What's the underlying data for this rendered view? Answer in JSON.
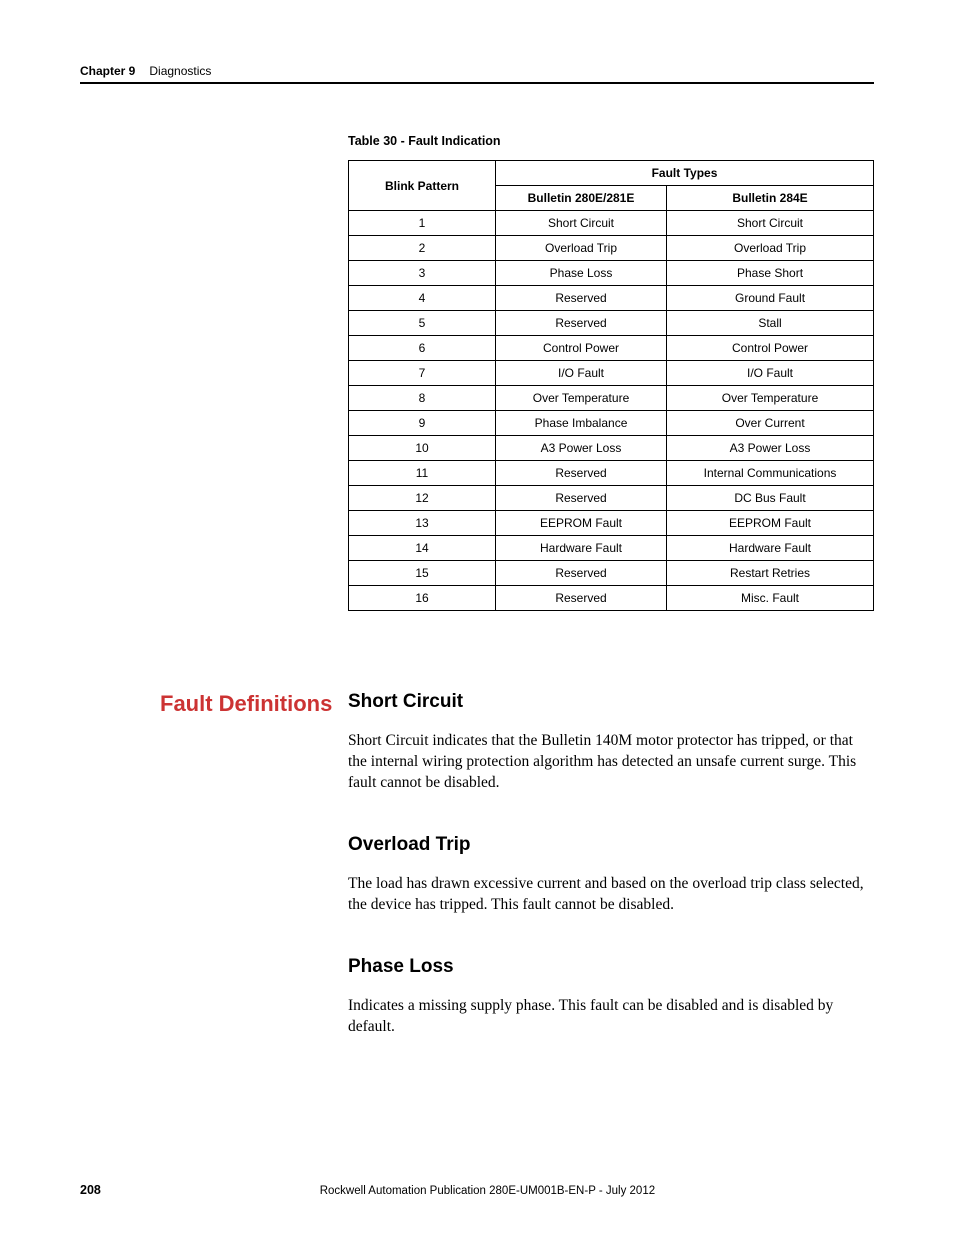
{
  "header": {
    "chapter": "Chapter 9",
    "section": "Diagnostics"
  },
  "table": {
    "caption": "Table 30 - Fault Indication",
    "col_blink": "Blink Pattern",
    "col_faulttypes": "Fault Types",
    "col_bulletin1": "Bulletin 280E/281E",
    "col_bulletin2": "Bulletin 284E",
    "rows": [
      {
        "n": "1",
        "a": "Short Circuit",
        "b": "Short Circuit"
      },
      {
        "n": "2",
        "a": "Overload Trip",
        "b": "Overload Trip"
      },
      {
        "n": "3",
        "a": "Phase Loss",
        "b": "Phase Short"
      },
      {
        "n": "4",
        "a": "Reserved",
        "b": "Ground Fault"
      },
      {
        "n": "5",
        "a": "Reserved",
        "b": "Stall"
      },
      {
        "n": "6",
        "a": "Control Power",
        "b": "Control Power"
      },
      {
        "n": "7",
        "a": "I/O Fault",
        "b": "I/O Fault"
      },
      {
        "n": "8",
        "a": "Over Temperature",
        "b": "Over Temperature"
      },
      {
        "n": "9",
        "a": "Phase Imbalance",
        "b": "Over Current"
      },
      {
        "n": "10",
        "a": "A3 Power Loss",
        "b": "A3 Power Loss"
      },
      {
        "n": "11",
        "a": "Reserved",
        "b": "Internal Communications"
      },
      {
        "n": "12",
        "a": "Reserved",
        "b": "DC Bus Fault"
      },
      {
        "n": "13",
        "a": "EEPROM Fault",
        "b": "EEPROM Fault"
      },
      {
        "n": "14",
        "a": "Hardware Fault",
        "b": "Hardware Fault"
      },
      {
        "n": "15",
        "a": "Reserved",
        "b": "Restart Retries"
      },
      {
        "n": "16",
        "a": "Reserved",
        "b": "Misc. Fault"
      }
    ]
  },
  "sidebar": {
    "fault_definitions": "Fault Definitions"
  },
  "sections": {
    "short_circuit": {
      "heading": "Short Circuit",
      "body": "Short Circuit indicates that the Bulletin 140M motor protector has tripped, or that the internal wiring protection algorithm has detected an unsafe current surge. This fault cannot be disabled."
    },
    "overload_trip": {
      "heading": "Overload Trip",
      "body": "The load has drawn excessive current and based on the overload trip class selected, the device has tripped. This fault cannot be disabled."
    },
    "phase_loss": {
      "heading": "Phase Loss",
      "body": "Indicates a missing supply phase. This fault can be disabled and is disabled by default."
    }
  },
  "footer": {
    "page": "208",
    "publication": "Rockwell Automation Publication 280E-UM001B-EN-P - July 2012"
  }
}
